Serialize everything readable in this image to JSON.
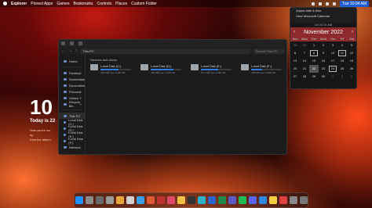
{
  "menubar": {
    "items": [
      "Explorer",
      "Pinned Apps",
      "Games",
      "Bookmarks",
      "Controls",
      "Places",
      "Custom Folder"
    ],
    "clock": "Tue 10:04 AM"
  },
  "widget": {
    "big_text": "10",
    "subtitle": "Today is 22",
    "note_line1": "Now you're loo",
    "note_line2": "by",
    "note_line3": "from the album"
  },
  "explorer": {
    "nav_back": "←",
    "nav_forward": "→",
    "nav_up": "↑",
    "address": "This PC",
    "search_placeholder": "Search This PC",
    "sidebar": [
      {
        "label": "Home",
        "pinned": false
      },
      {
        "label": "Desktop",
        "pinned": true
      },
      {
        "label": "Downloads",
        "pinned": true
      },
      {
        "label": "Documents",
        "pinned": true
      },
      {
        "label": "Pictures",
        "pinned": true
      },
      {
        "label": "Videos",
        "pinned": true
      },
      {
        "label": "Recycle Bin",
        "pinned": true
      },
      {
        "label": "This PC",
        "pinned": false,
        "selected": true
      },
      {
        "label": "Local Disk (C:)",
        "pinned": false
      },
      {
        "label": "Local Disk (D:)",
        "pinned": false
      },
      {
        "label": "Local Disk (E:)",
        "pinned": false
      },
      {
        "label": "Local Disk (F:)",
        "pinned": false
      },
      {
        "label": "Network",
        "pinned": false
      }
    ],
    "section_title": "Devices and drives",
    "drives": [
      {
        "name": "Local Disk (C:)",
        "free": "48.5 GB free of 118 GB",
        "used_fraction": 0.59
      },
      {
        "name": "Local Disk (D:)",
        "free": "120 GB free of 465 GB",
        "used_fraction": 0.74
      },
      {
        "name": "Local Disk (E:)",
        "free": "51.2 GB free of 115 GB",
        "used_fraction": 0.55
      },
      {
        "name": "Local Disk (F:)",
        "free": "298 GB free of 465 GB",
        "used_fraction": 0.36
      }
    ]
  },
  "flyout": {
    "menu": [
      "Adjust date & time",
      "View Microsoft Calendar"
    ],
    "time": "10:04:13 AM",
    "month": "November 2022",
    "prev": "‹",
    "next": "›",
    "dow": [
      "Sun",
      "Mon",
      "Tue",
      "Wed",
      "Thu",
      "Fri",
      "Sat"
    ],
    "days": [
      "30",
      "31",
      "1",
      "2",
      "3",
      "4",
      "5",
      "6",
      "7",
      "8",
      "9",
      "10",
      "11",
      "12",
      "13",
      "14",
      "15",
      "16",
      "17",
      "18",
      "19",
      "20",
      "21",
      "22",
      "23",
      "24",
      "25",
      "26",
      "27",
      "28",
      "29",
      "30",
      "1",
      "2",
      "3"
    ],
    "today": "22",
    "selected": [
      "8",
      "11",
      "24"
    ]
  },
  "dock": {
    "apps": [
      {
        "name": "finder-icon",
        "color": "#1e90ff"
      },
      {
        "name": "launchpad-icon",
        "color": "#8a8a8a"
      },
      {
        "name": "recycle-icon",
        "color": "#6a6a6a"
      },
      {
        "name": "settings-icon",
        "color": "#9a9a9a"
      },
      {
        "name": "chrome-icon",
        "color": "#e8a33a"
      },
      {
        "name": "store-icon",
        "color": "#d0d0d0"
      },
      {
        "name": "mail-icon",
        "color": "#3aa0e8"
      },
      {
        "name": "photos-icon",
        "color": "#e05a3a"
      },
      {
        "name": "video-icon",
        "color": "#c03030"
      },
      {
        "name": "music-icon",
        "color": "#e04a6a"
      },
      {
        "name": "files-icon",
        "color": "#f0c040"
      },
      {
        "name": "terminal-icon",
        "color": "#333333"
      },
      {
        "name": "edge-icon",
        "color": "#2db0c8"
      },
      {
        "name": "word-icon",
        "color": "#2b64c8"
      },
      {
        "name": "excel-icon",
        "color": "#1f8a4c"
      },
      {
        "name": "teams-icon",
        "color": "#5a5ac8"
      },
      {
        "name": "spotify-icon",
        "color": "#1db954"
      },
      {
        "name": "discord-icon",
        "color": "#5865f2"
      },
      {
        "name": "code-icon",
        "color": "#2b8ae0"
      },
      {
        "name": "notes-icon",
        "color": "#f0d040"
      },
      {
        "name": "calendar-icon",
        "color": "#e04040"
      },
      {
        "name": "downloads-icon",
        "color": "#888888"
      },
      {
        "name": "trash-icon",
        "color": "#777777"
      }
    ]
  }
}
